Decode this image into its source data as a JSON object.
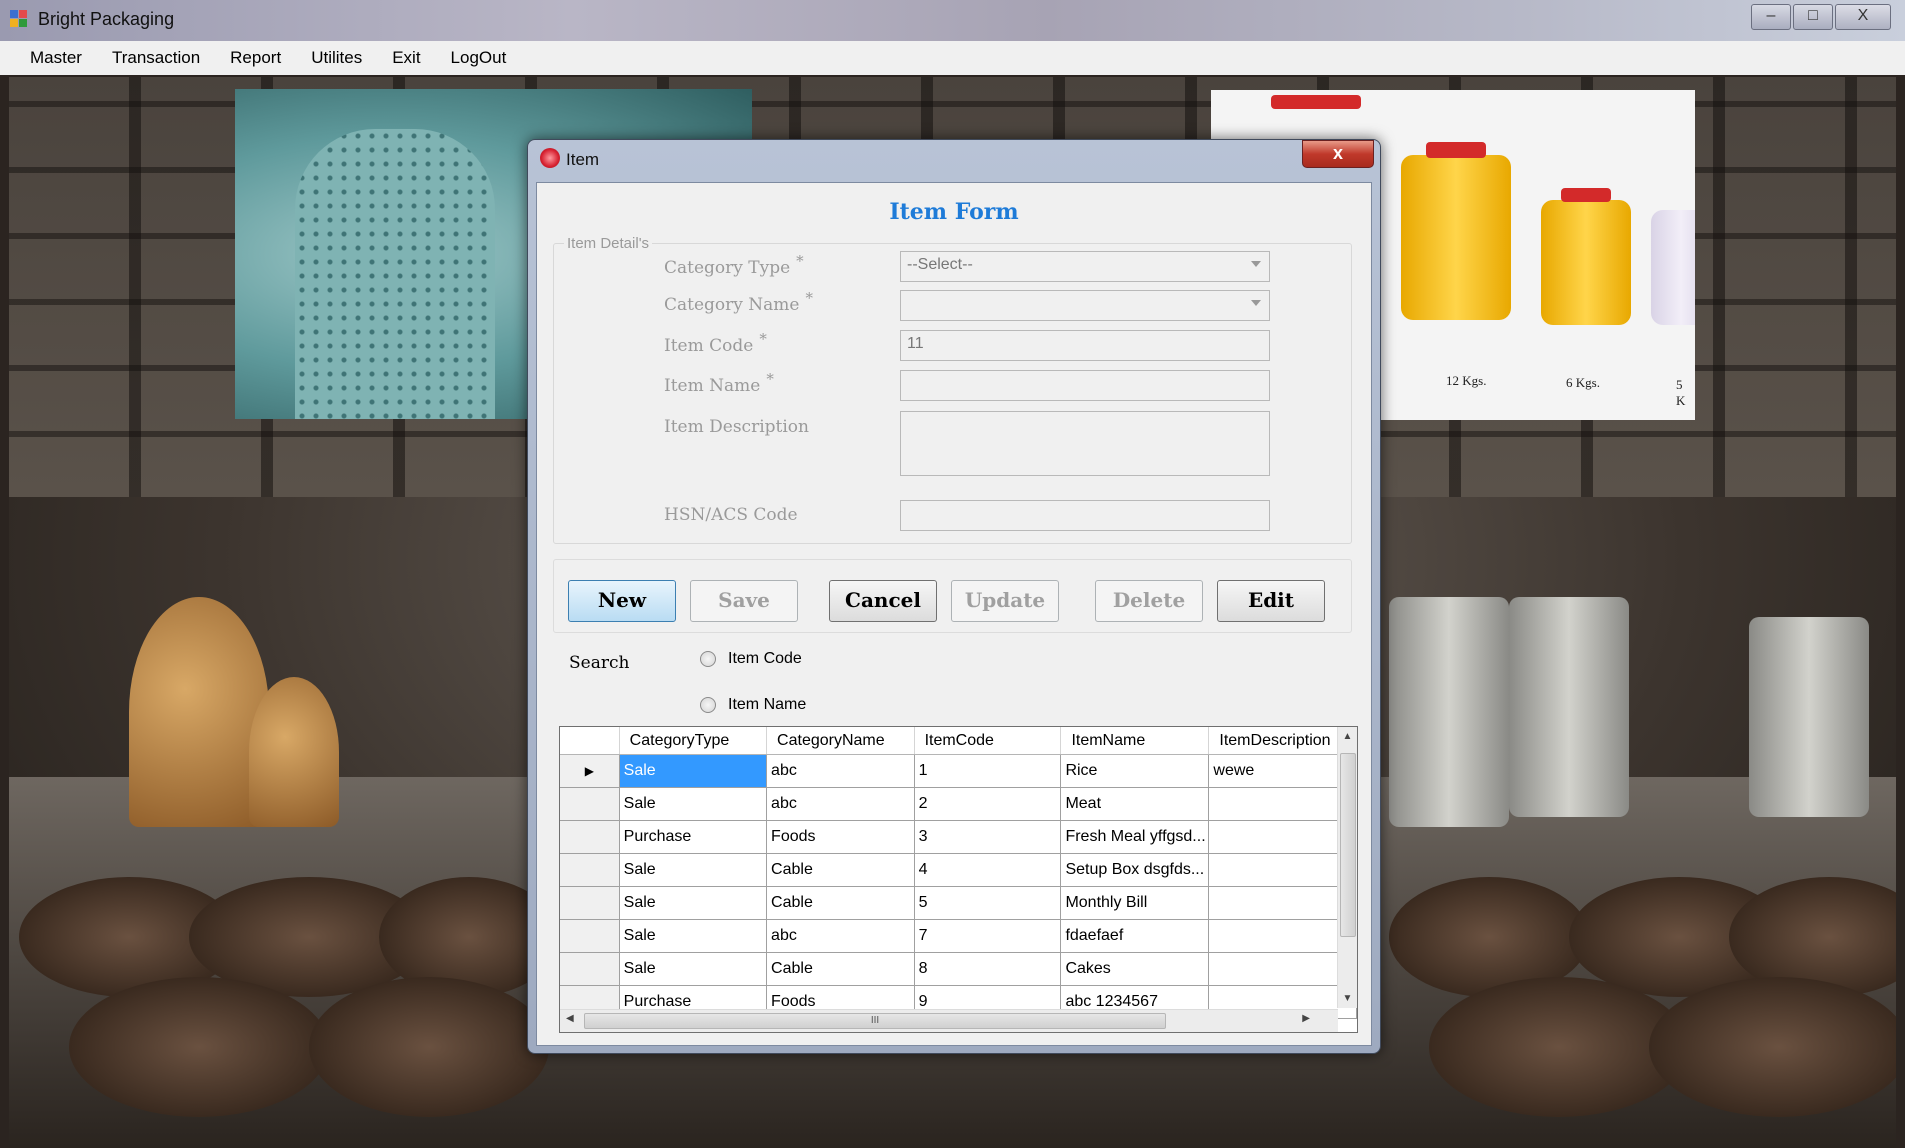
{
  "app": {
    "title": "Bright Packaging",
    "min": "–",
    "max": "□",
    "close": "X"
  },
  "menu": [
    "Master",
    "Transaction",
    "Report",
    "Utilites",
    "Exit",
    "LogOut"
  ],
  "photo_labels": [
    "12 Kgs.",
    "6 Kgs.",
    "5 K"
  ],
  "dialog": {
    "title": "Item",
    "close": "x",
    "form_title": "Item Form",
    "group_title": "Item Detail's",
    "required_mark": "*",
    "labels": {
      "category_type": "Category Type",
      "category_name": "Category Name",
      "item_code": "Item Code",
      "item_name": "Item Name",
      "item_description": "Item Description",
      "hsn_code": "HSN/ACS Code"
    },
    "values": {
      "category_type": "--Select--",
      "category_name": "",
      "item_code": "11",
      "item_name": "",
      "item_description": "",
      "hsn_code": ""
    },
    "buttons": {
      "new": "New",
      "save": "Save",
      "cancel": "Cancel",
      "update": "Update",
      "delete": "Delete",
      "edit": "Edit"
    },
    "search": {
      "label": "Search",
      "option_code": "Item Code",
      "option_name": "Item Name"
    }
  },
  "grid": {
    "columns": [
      "CategoryType",
      "CategoryName",
      "ItemCode",
      "ItemName",
      "ItemDescription"
    ],
    "rows": [
      [
        "Sale",
        "abc",
        "1",
        "Rice",
        "wewe"
      ],
      [
        "Sale",
        "abc",
        "2",
        "Meat",
        ""
      ],
      [
        "Purchase",
        "Foods",
        "3",
        "Fresh Meal yffgsd...",
        ""
      ],
      [
        "Sale",
        "Cable",
        "4",
        "Setup Box dsgfds...",
        ""
      ],
      [
        "Sale",
        "Cable",
        "5",
        "Monthly Bill",
        ""
      ],
      [
        "Sale",
        "abc",
        "7",
        "fdaefaef",
        ""
      ],
      [
        "Sale",
        "Cable",
        "8",
        "Cakes",
        ""
      ],
      [
        "Purchase",
        "Foods",
        "9",
        "abc 1234567",
        ""
      ]
    ],
    "current_row_marker": "▶",
    "scroll_thumb_grip": "III"
  }
}
